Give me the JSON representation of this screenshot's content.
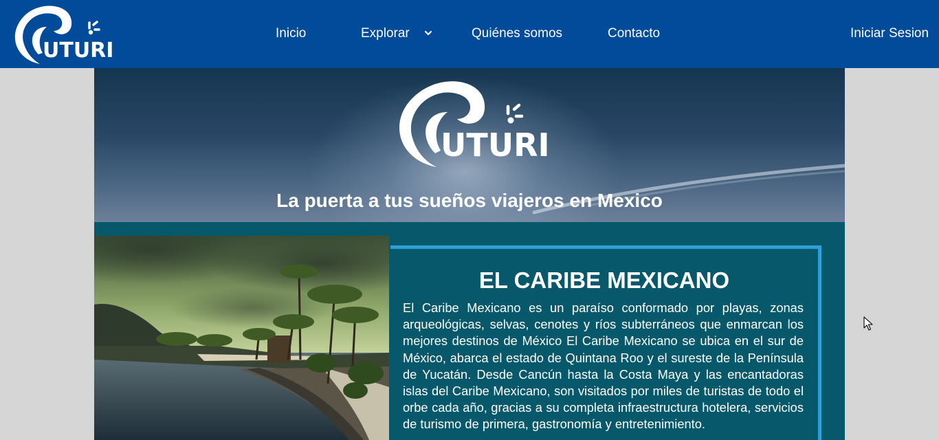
{
  "navbar": {
    "logo_text": "UTURI",
    "links": [
      {
        "label": "Inicio"
      },
      {
        "label": "Explorar"
      },
      {
        "label": "Quiénes somos"
      },
      {
        "label": "Contacto"
      }
    ],
    "login_label": "Iniciar Sesion",
    "background_color": "#014b9a"
  },
  "hero": {
    "logo_text": "UTURI",
    "tagline": "La puerta a tus sueños viajeros en Mexico"
  },
  "article": {
    "title": "EL CARIBE MEXICANO",
    "body": "El Caribe Mexicano es un paraíso conformado por playas, zonas arqueológicas, selvas, cenotes y ríos subterráneos que enmarcan los mejores destinos de México El Caribe Mexicano se ubica en el sur de México, abarca el estado de Quintana Roo y el sureste de la Península de Yucatán. Desde Cancún hasta la Costa Maya y las encantadoras islas del Caribe Mexicano, son visitados por miles de turistas de todo el orbe cada año, gracias a su completa infraestructura hotelera, servicios de turismo de primera, gastronomía y entretenimiento.",
    "accent_color": "#2f9fda",
    "panel_color": "#07586a"
  },
  "icons": {
    "explorar_toggle": "chevron-down-icon",
    "pointer": "mouse-cursor-icon"
  }
}
